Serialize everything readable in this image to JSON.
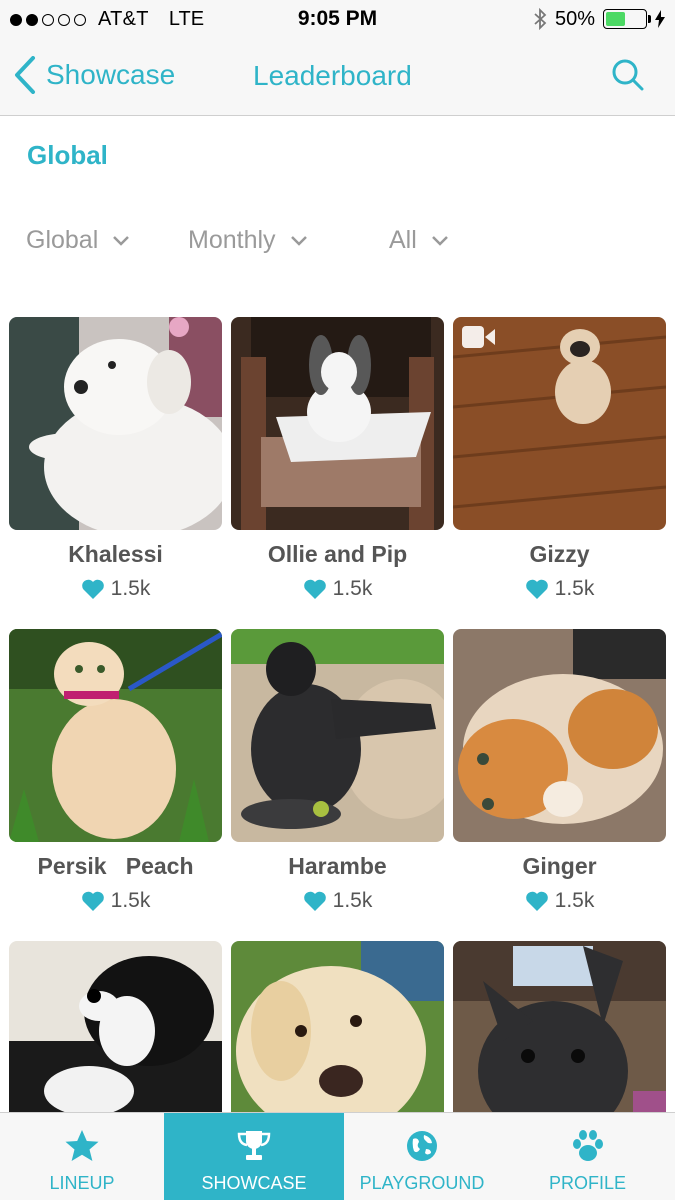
{
  "status_bar": {
    "carrier": "AT&T",
    "network": "LTE",
    "time": "9:05 PM",
    "battery": "50%",
    "battery_level": 0.5
  },
  "nav": {
    "back_label": "Showcase",
    "title": "Leaderboard"
  },
  "section_title": "Global",
  "filters": [
    {
      "label": "Global"
    },
    {
      "label": "Monthly"
    },
    {
      "label": "All"
    }
  ],
  "pets": [
    {
      "name": "Khalessi",
      "likes": "1.5k",
      "video": false
    },
    {
      "name": "Ollie and Pip",
      "likes": "1.5k",
      "video": false
    },
    {
      "name": "Gizzy",
      "likes": "1.5k",
      "video": true
    },
    {
      "name": "Persik   Peach",
      "likes": "1.5k",
      "video": false
    },
    {
      "name": "Harambe",
      "likes": "1.5k",
      "video": false
    },
    {
      "name": "Ginger",
      "likes": "1.5k",
      "video": false
    },
    {
      "name": "",
      "likes": "",
      "video": false
    },
    {
      "name": "",
      "likes": "",
      "video": false
    },
    {
      "name": "",
      "likes": "",
      "video": false
    }
  ],
  "tabs": [
    {
      "label": "LINEUP",
      "icon": "star-icon",
      "active": false
    },
    {
      "label": "SHOWCASE",
      "icon": "trophy-icon",
      "active": true
    },
    {
      "label": "PLAYGROUND",
      "icon": "globe-icon",
      "active": false
    },
    {
      "label": "PROFILE",
      "icon": "paw-icon",
      "active": false
    }
  ],
  "colors": {
    "accent": "#2fb4c8",
    "battery": "#4cd964",
    "heart": "#2fb4c8"
  }
}
